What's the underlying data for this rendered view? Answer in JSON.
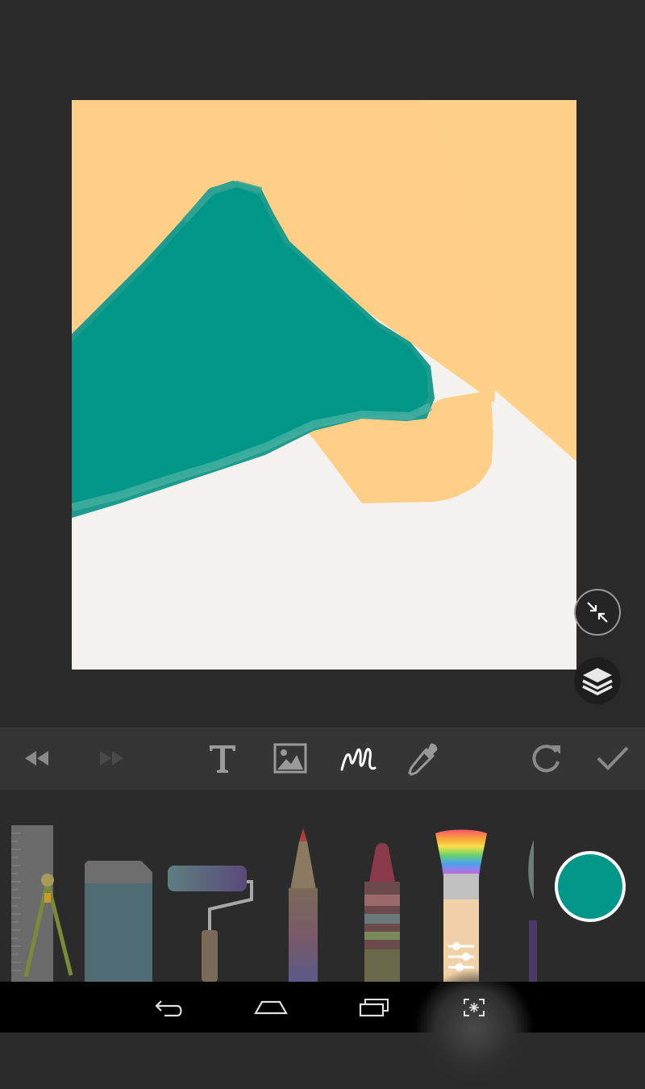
{
  "app": {
    "colors": {
      "background": "#2a2a2a",
      "toolbar": "#353535",
      "tray": "#2b2b2b",
      "canvas": "#f4f2ef",
      "peach": "#ffcf87",
      "teal": "#009688",
      "selected_color": "#009688"
    }
  },
  "canvas_controls": {
    "collapse_icon": "collapse-arrows-icon",
    "layers_icon": "layers-icon"
  },
  "toolbar": {
    "items": [
      {
        "name": "undo",
        "icon": "rewind-icon",
        "enabled": true
      },
      {
        "name": "redo",
        "icon": "fast-forward-icon",
        "enabled": false
      },
      {
        "name": "text",
        "icon": "text-icon"
      },
      {
        "name": "image",
        "icon": "image-icon"
      },
      {
        "name": "brush",
        "icon": "squiggle-icon",
        "selected": true
      },
      {
        "name": "eyedropper",
        "icon": "eyedropper-icon"
      },
      {
        "name": "rotate",
        "icon": "rotate-icon"
      },
      {
        "name": "done",
        "icon": "checkmark-icon"
      }
    ]
  },
  "tools_tray": {
    "tools": [
      "ruler-compass",
      "eraser",
      "paint-roller",
      "pencil",
      "crayon",
      "paintbrush",
      "watercolor-brush"
    ],
    "selected_tool": "paintbrush"
  },
  "nav_bar": {
    "buttons": [
      "back-icon",
      "home-icon",
      "recent-apps-icon",
      "screenshot-icon"
    ]
  }
}
